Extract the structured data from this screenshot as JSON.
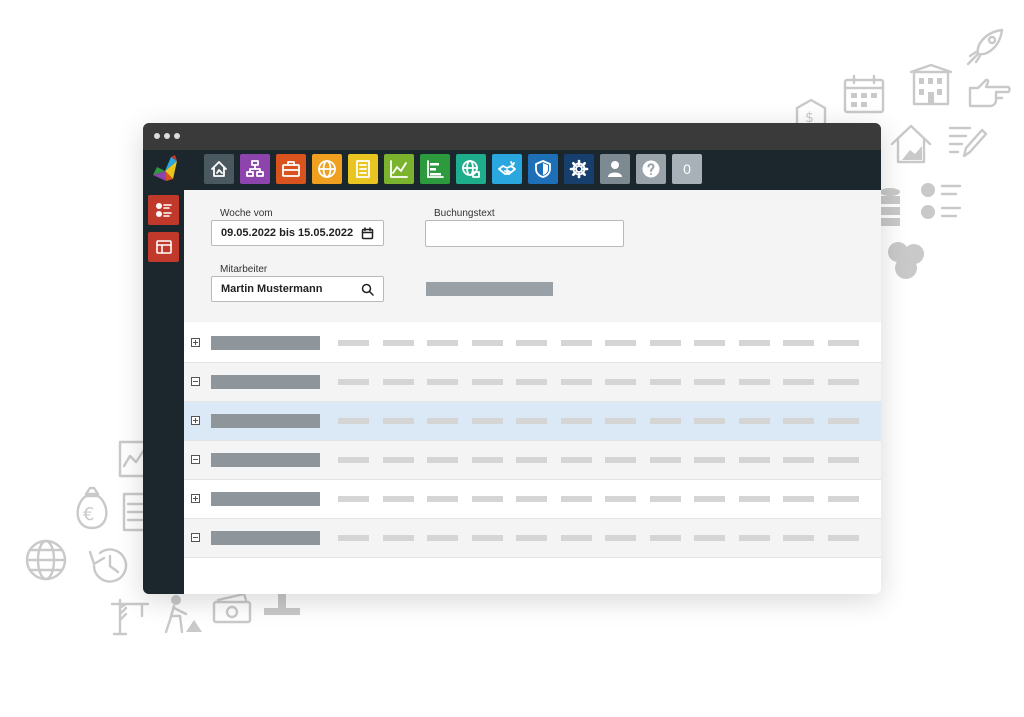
{
  "window": {
    "toolbar": {
      "items": [
        {
          "name": "home-icon",
          "color": "#4a5860"
        },
        {
          "name": "org-chart-icon",
          "color": "#8e44ad"
        },
        {
          "name": "briefcase-icon",
          "color": "#d9531e"
        },
        {
          "name": "globe-icon",
          "color": "#f0a020"
        },
        {
          "name": "document-icon",
          "color": "#e8c520"
        },
        {
          "name": "chart-icon",
          "color": "#7cb32e"
        },
        {
          "name": "gantt-icon",
          "color": "#2e9a3e"
        },
        {
          "name": "network-globe-icon",
          "color": "#1fae8c"
        },
        {
          "name": "handshake-icon",
          "color": "#2aa7df"
        },
        {
          "name": "shield-icon",
          "color": "#1d6fb8"
        },
        {
          "name": "gear-icon",
          "color": "#173f6e"
        },
        {
          "name": "user-icon",
          "color": "#7e8a92"
        },
        {
          "name": "help-icon",
          "color": "#9aa3a9"
        },
        {
          "name": "notification-count",
          "color": "#a8b1b7"
        }
      ],
      "notification_count": "0"
    },
    "sidebar": {
      "items": [
        {
          "name": "checklist-icon"
        },
        {
          "name": "layout-icon"
        }
      ]
    },
    "form": {
      "week_label": "Woche vom",
      "week_value": "09.05.2022 bis 15.05.2022",
      "booking_text_label": "Buchungstext",
      "booking_text_value": "",
      "employee_label": "Mitarbeiter",
      "employee_value": "Martin Mustermann"
    },
    "rows": [
      {
        "state": "collapsed",
        "selected": false
      },
      {
        "state": "expanded",
        "selected": false
      },
      {
        "state": "collapsed",
        "selected": true
      },
      {
        "state": "expanded",
        "selected": false
      },
      {
        "state": "collapsed",
        "selected": false
      },
      {
        "state": "expanded",
        "selected": false
      }
    ],
    "accent_color": "#c0392b"
  }
}
